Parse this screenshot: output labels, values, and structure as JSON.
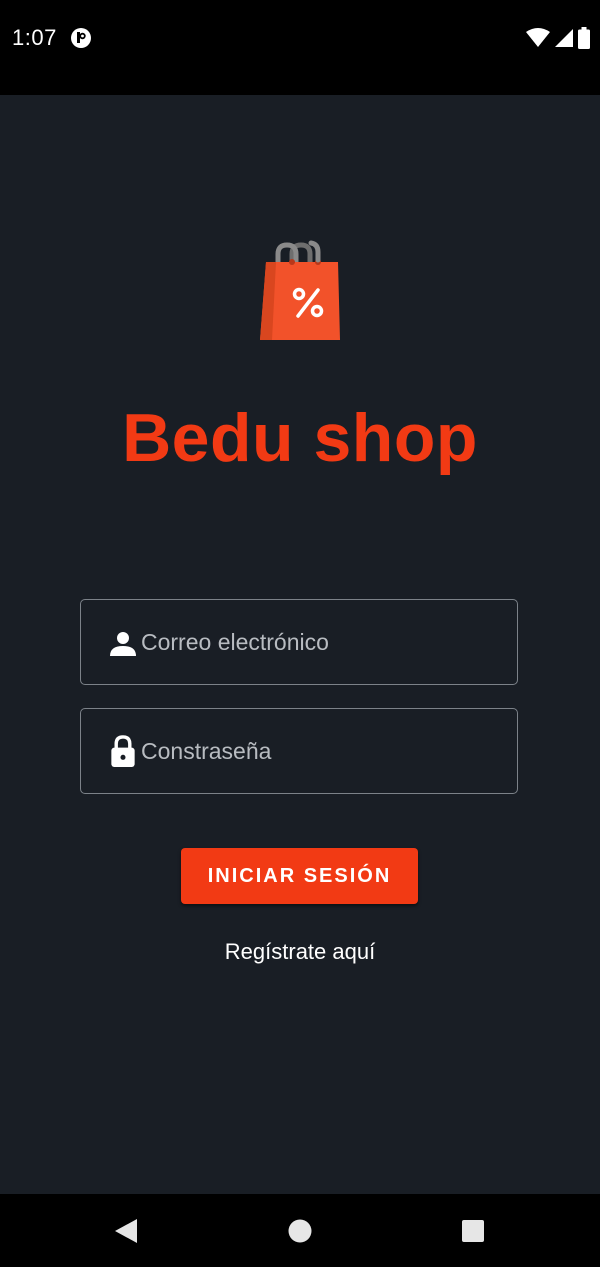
{
  "status_bar": {
    "time": "1:07",
    "icons": [
      "app-notification-icon",
      "wifi-icon",
      "signal-icon",
      "battery-icon"
    ]
  },
  "app": {
    "logo_icon": "shopping-bag-percent-icon",
    "title": "Bedu shop"
  },
  "form": {
    "email": {
      "icon": "person-icon",
      "placeholder": "Correo electrónico",
      "value": ""
    },
    "password": {
      "icon": "lock-icon",
      "placeholder": "Constraseña",
      "value": ""
    },
    "login_label": "INICIAR SESIÓN",
    "register_label": "Regístrate aquí"
  },
  "nav_bar": {
    "icons": [
      "back-icon",
      "home-icon",
      "recents-icon"
    ]
  },
  "colors": {
    "accent": "#f23a14",
    "background": "#191e25",
    "field_border": "#7c8289"
  }
}
